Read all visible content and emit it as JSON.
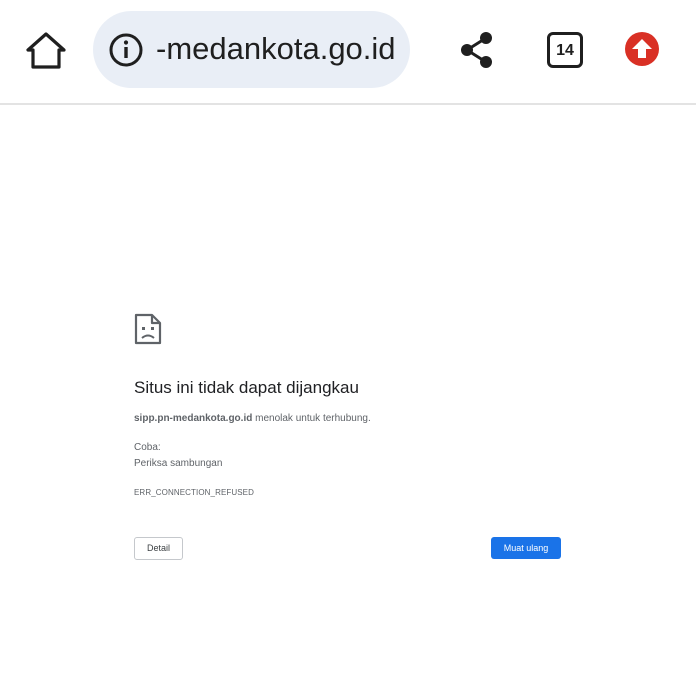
{
  "toolbar": {
    "url": "-medankota.go.id",
    "tab_count": "14",
    "icons": [
      "home-icon",
      "info-icon",
      "share-icon",
      "tab-switcher-icon",
      "update-arrow-icon"
    ],
    "colors": {
      "omnibox_bg": "#e9eef6",
      "update_badge": "#d93025"
    }
  },
  "error": {
    "icon": "sad-document-icon",
    "title": "Situs ini tidak dapat dijangkau",
    "host": "sipp.pn-medankota.go.id",
    "description": " menolak untuk terhubung.",
    "try_label": "Coba:",
    "suggestion": "Periksa sambungan",
    "code": "ERR_CONNECTION_REFUSED",
    "details_label": "Detail",
    "reload_label": "Muat ulang",
    "colors": {
      "primary": "#1a73e8"
    }
  }
}
